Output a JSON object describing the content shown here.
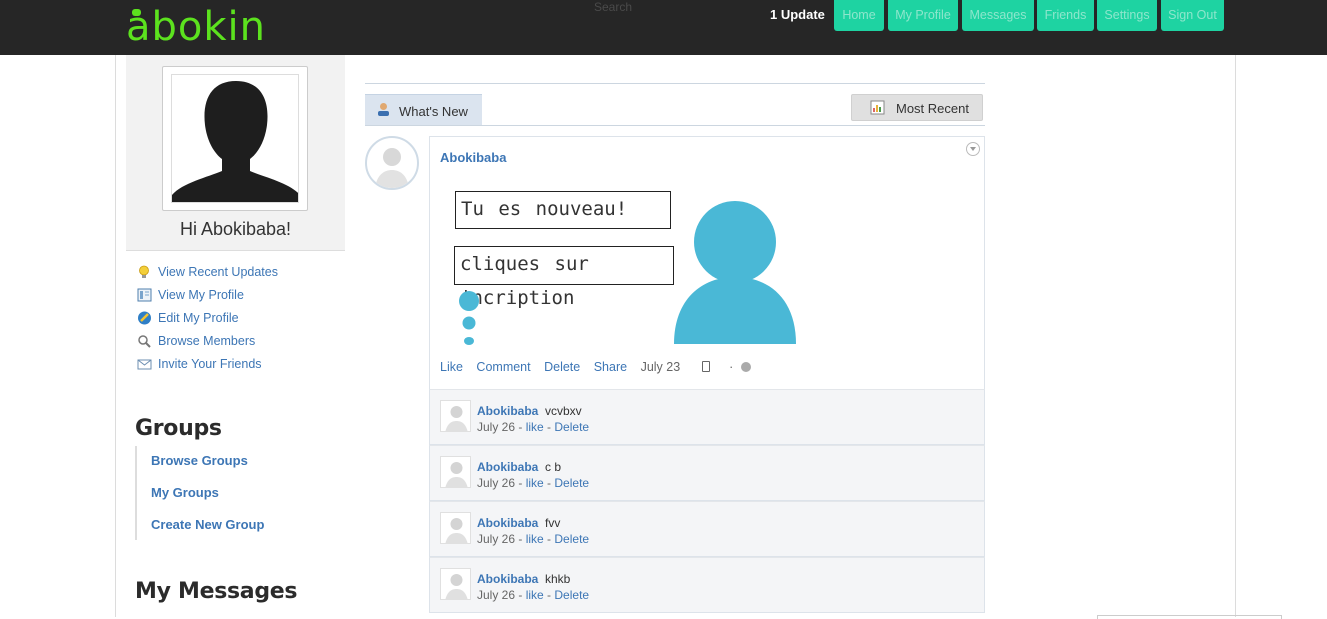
{
  "header": {
    "logo": "abokin",
    "search_placeholder": "Search",
    "updates": "1 Update",
    "nav": [
      "Home",
      "My Profile",
      "Messages",
      "Friends",
      "Settings",
      "Sign Out"
    ]
  },
  "sidebar": {
    "greeting": "Hi Abokibaba!",
    "links": [
      {
        "label": "View Recent Updates",
        "icon": "lightbulb-icon"
      },
      {
        "label": "View My Profile",
        "icon": "profile-page-icon"
      },
      {
        "label": "Edit My Profile",
        "icon": "pencil-icon"
      },
      {
        "label": "Browse Members",
        "icon": "magnifier-icon"
      },
      {
        "label": "Invite Your Friends",
        "icon": "envelope-icon"
      }
    ],
    "groups_heading": "Groups",
    "groups": [
      "Browse Groups",
      "My Groups",
      "Create New Group"
    ],
    "messages_heading": "My Messages"
  },
  "tabs": {
    "whats_new": "What's New",
    "most_recent": "Most Recent"
  },
  "post": {
    "author": "Abokibaba",
    "bubble1": "Tu es nouveau!",
    "bubble2": "cliques sur incription",
    "actions": [
      "Like",
      "Comment",
      "Delete",
      "Share"
    ],
    "date": "July 23",
    "separator": "·"
  },
  "comments": [
    {
      "author": "Abokibaba",
      "text": "vcvbxv",
      "date": "July 26",
      "like": "like",
      "delete": "Delete"
    },
    {
      "author": "Abokibaba",
      "text": "c b",
      "date": "July 26",
      "like": "like",
      "delete": "Delete"
    },
    {
      "author": "Abokibaba",
      "text": "fvv",
      "date": "July 26",
      "like": "like",
      "delete": "Delete"
    },
    {
      "author": "Abokibaba",
      "text": "khkb",
      "date": "July 26",
      "like": "like",
      "delete": "Delete"
    }
  ],
  "colors": {
    "topbar": "#262626",
    "logo": "#5ce21e",
    "nav_button": "#1ed3a2",
    "link": "#3d76b5",
    "illustration": "#4ab8d6"
  }
}
